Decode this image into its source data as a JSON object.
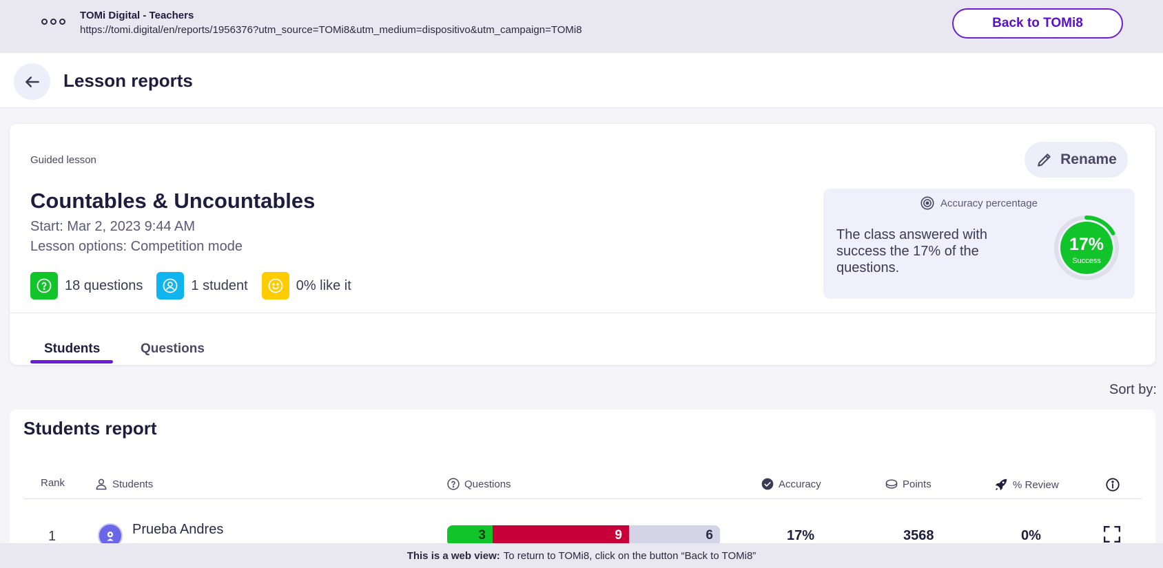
{
  "webview": {
    "title": "TOMi Digital - Teachers",
    "url": "https://tomi.digital/en/reports/1956376?utm_source=TOMi8&utm_medium=dispositivo&utm_campaign=TOMi8",
    "back_label": "Back to TOMi8"
  },
  "header": {
    "title": "Lesson reports"
  },
  "lesson": {
    "kind": "Guided lesson",
    "title": "Countables & Uncountables",
    "start": "Start: Mar 2, 2023 9:44 AM",
    "options": "Lesson options:  Competition mode",
    "rename_label": "Rename",
    "stats": {
      "questions": "18 questions",
      "students": "1 student",
      "likes": "0% like it"
    }
  },
  "accuracy": {
    "label": "Accuracy percentage",
    "text": "The class answered with success the 17% of the questions.",
    "percent_label": "17%",
    "sub_label": "Success",
    "value": 0.17
  },
  "tabs": {
    "students": "Students",
    "questions": "Questions"
  },
  "sort_label": "Sort by:",
  "report": {
    "title": "Students report",
    "columns": {
      "rank": "Rank",
      "students": "Students",
      "questions": "Questions",
      "accuracy": "Accuracy",
      "points": "Points",
      "review": "% Review"
    },
    "rows": [
      {
        "rank": "1",
        "name": "Prueba Andres",
        "correct": "3",
        "wrong": "9",
        "unanswered": "6",
        "accuracy": "17%",
        "points": "3568",
        "review": "0%"
      }
    ]
  },
  "footer": {
    "bold": "This is a web view:",
    "text": "To return to TOMi8, click on the button “Back to TOMi8”"
  },
  "colors": {
    "accent": "#6a1fd6",
    "success": "#10c42a",
    "error": "#c8003a",
    "info": "#10b4ee",
    "warning": "#ffcc00"
  }
}
